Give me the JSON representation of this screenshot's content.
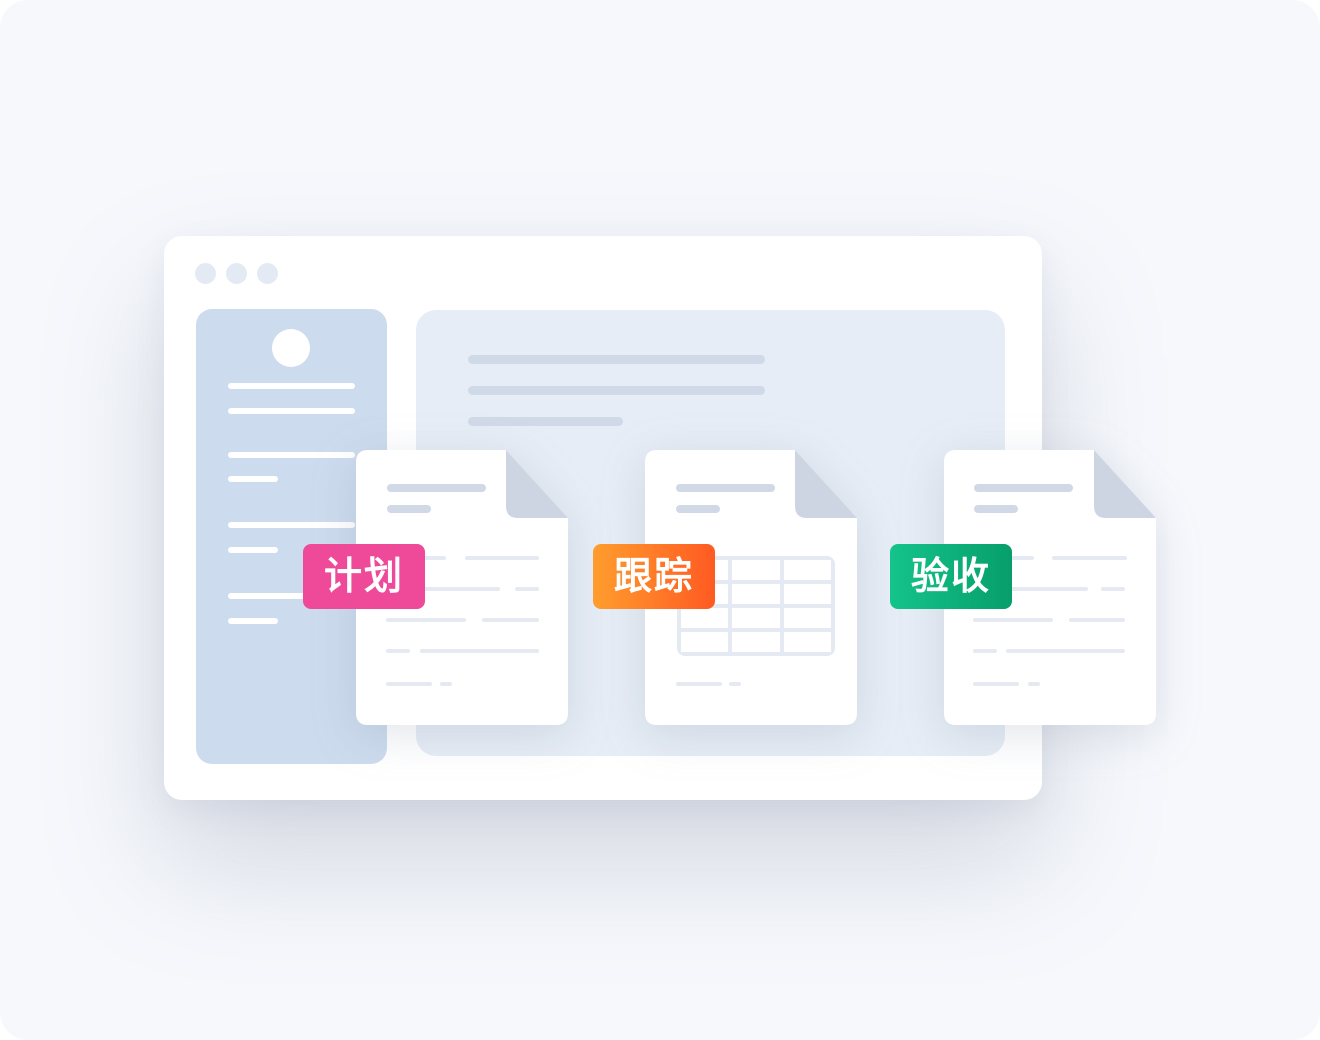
{
  "tags": {
    "plan": "计划",
    "track": "跟踪",
    "accept": "验收"
  },
  "colors": {
    "plan": "#ee4a99",
    "track_start": "#ff9d2d",
    "track_end": "#ff5a22",
    "accept_start": "#14c48a",
    "accept_end": "#079e6b",
    "sidebar": "#cddbee",
    "content": "#e6edf6"
  }
}
